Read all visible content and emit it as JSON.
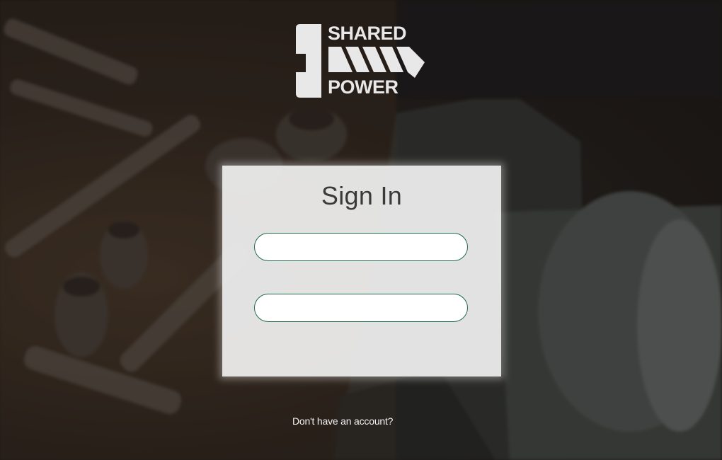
{
  "brand": {
    "name_top": "SHARED",
    "name_bottom": "POWER",
    "logo_color": "#e8e8e8"
  },
  "signin": {
    "title": "Sign In",
    "username_value": "",
    "password_value": "",
    "field_border_color": "#1f6b4a"
  },
  "footer": {
    "signup_link": "Don't have an account?"
  },
  "background": {
    "description_icon": "workshop-tools-background"
  }
}
